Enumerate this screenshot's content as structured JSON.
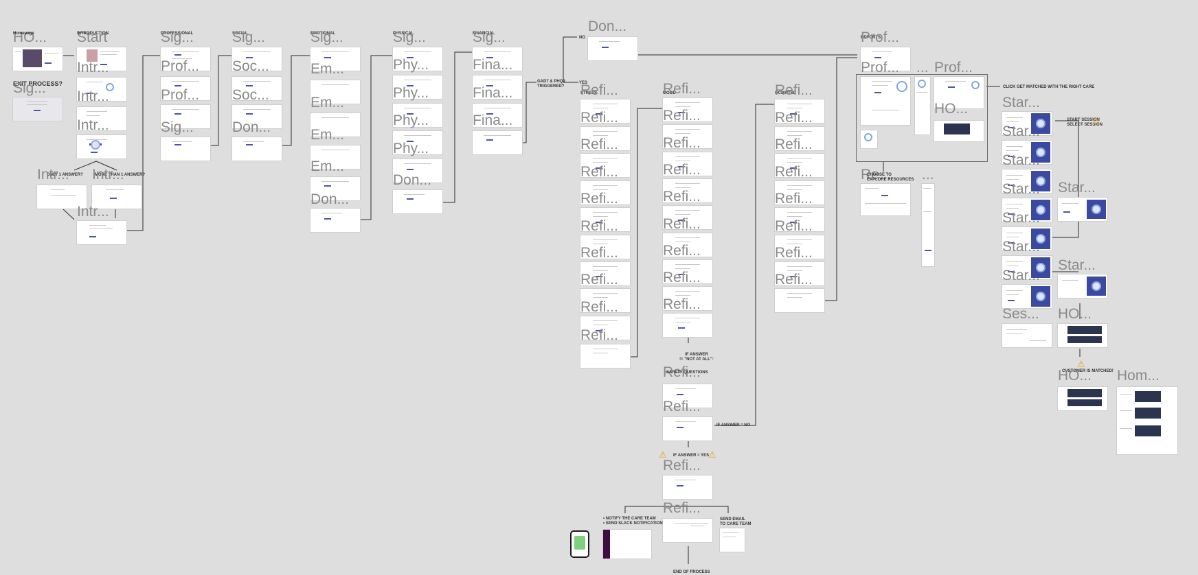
{
  "canvas": {
    "background": "#dedede",
    "accent": "#4a55a2",
    "labels": {
      "ho": "HO...",
      "hom": "Hom...",
      "start": "Start",
      "sig": "Sig...",
      "intr": "Intr...",
      "prof": "Prof...",
      "soc": "Soc...",
      "don": "Don...",
      "em": "Em...",
      "phy": "Phy...",
      "fina": "Fina...",
      "refi": "Refi...",
      "star": "Star...",
      "ses": "Ses...",
      "re": "Re...",
      "dots": "...",
      "exit_process": "EXIT PROCESS?",
      "homepage": "Homepage",
      "introduction": "INTRODUCTION",
      "professional": "PROFESSIONAL",
      "social": "SOCIAL",
      "emotional": "EMOTIONAL",
      "physical": "PHYSICAL",
      "financial": "FINANCIAL",
      "only1": "ONLY 1 ANSWER?",
      "more_than_1": "MORE THAN 1 ANSWER?",
      "no": "NO",
      "yes": "YES",
      "gad_phq": "GAD7 & PHQ9\nTRIGGERED?",
      "stress": "STRESS",
      "mood": "MOOD",
      "ocd": "OCD/PTSD",
      "reports": "REPORTS",
      "if_not_at_all": "IF ANSWER\n!= \"NOT AT ALL\":",
      "safety_questions": "SAFETY QUESTIONS",
      "if_answer_yes": "IF ANSWER = YES",
      "if_answer_no": "IF ANSWER = NO",
      "notify_care_team": "• NOTIFY THE CARE TEAM\n• SEND SLACK NOTIFICATION",
      "send_email": "SEND EMAIL\nTO CARE TEAM",
      "end_process": "END OF PROCESS",
      "choose_resources": "CHOOSE TO\nEXPLORE RESOURCES",
      "click_matched": "CLICK GET MATCHED WITH THE RIGHT CARE",
      "customer_matched": "CUSTOMER IS MATCHED!",
      "start_session": "START SESSION\nSELECT SESSION"
    }
  }
}
